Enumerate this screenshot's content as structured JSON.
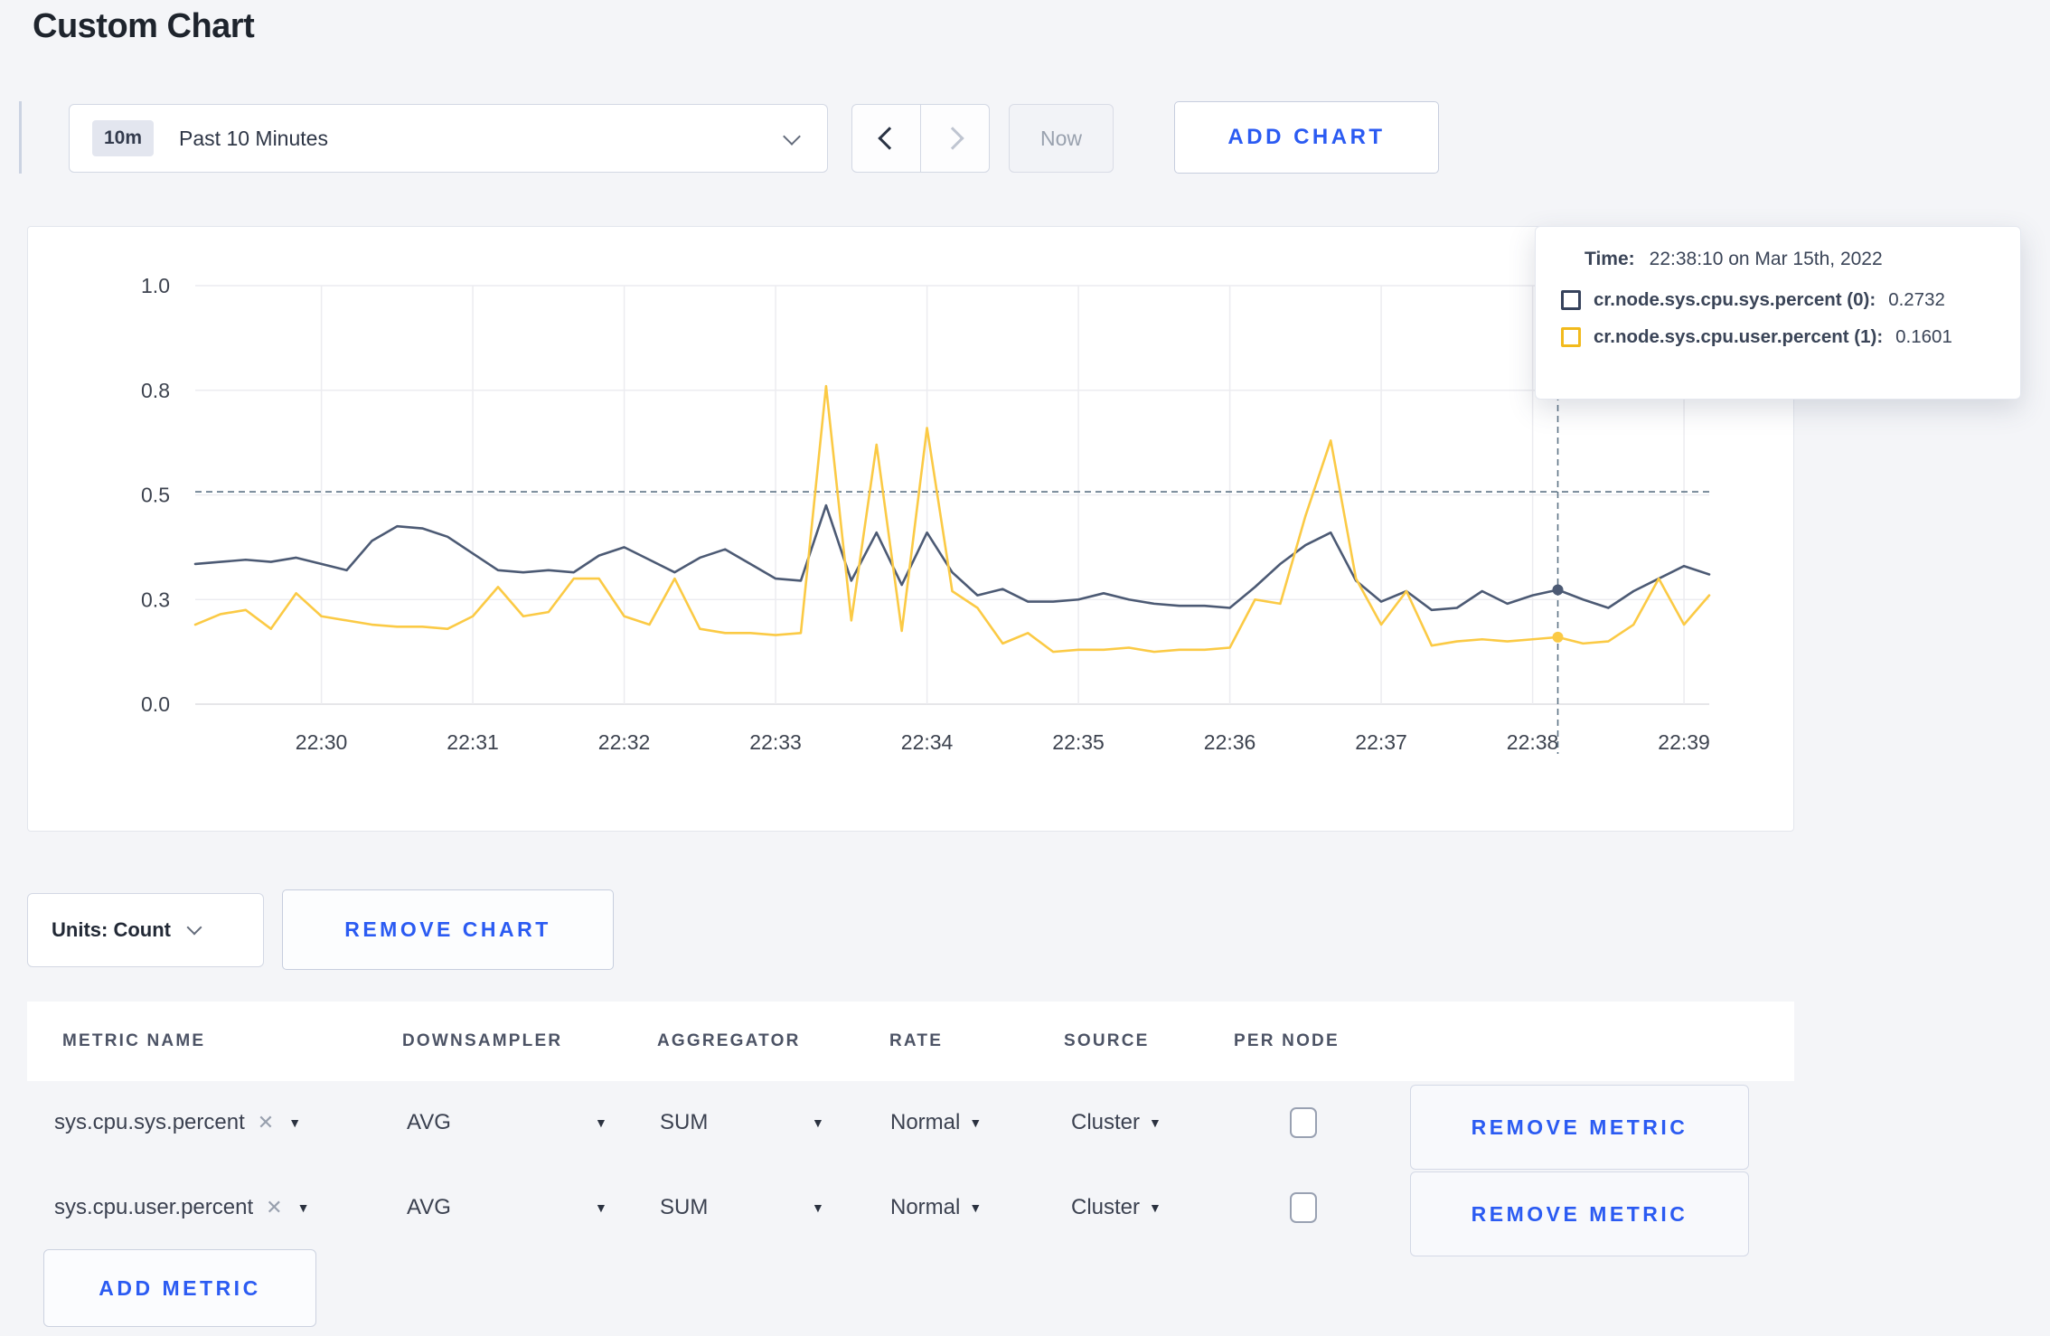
{
  "page": {
    "title": "Custom Chart"
  },
  "toolbar": {
    "time_range": {
      "badge": "10m",
      "label": "Past 10 Minutes"
    },
    "now_label": "Now",
    "add_chart_label": "ADD CHART"
  },
  "chart_data": {
    "type": "line",
    "start_time": "22:29:10",
    "interval_seconds": 10,
    "x_axis": {
      "tick_labels": [
        "22:30",
        "22:31",
        "22:32",
        "22:33",
        "22:34",
        "22:35",
        "22:36",
        "22:37",
        "22:38",
        "22:39"
      ],
      "tick_start_index": 5,
      "ticks_every_points": 6
    },
    "y_axis": {
      "range": [
        0,
        1
      ],
      "ticks": [
        {
          "label": "0.0",
          "value": 0
        },
        {
          "label": "0.3",
          "value": 0.25
        },
        {
          "label": "0.5",
          "value": 0.5
        },
        {
          "label": "0.8",
          "value": 0.75
        },
        {
          "label": "1.0",
          "value": 1
        }
      ]
    },
    "grid_color": "#ececf0",
    "crosshair": {
      "index": 54,
      "h_value": 0.5075,
      "color": "#5e7486"
    },
    "series": [
      {
        "id": "sys",
        "name": "cr.node.sys.cpu.sys.percent (0)",
        "color": "#4c5a74",
        "values": [
          0.335,
          0.34,
          0.345,
          0.34,
          0.35,
          0.335,
          0.32,
          0.39,
          0.425,
          0.42,
          0.4,
          0.36,
          0.32,
          0.315,
          0.32,
          0.315,
          0.355,
          0.375,
          0.345,
          0.315,
          0.35,
          0.37,
          0.335,
          0.3,
          0.295,
          0.475,
          0.295,
          0.41,
          0.285,
          0.41,
          0.315,
          0.26,
          0.275,
          0.245,
          0.245,
          0.25,
          0.265,
          0.25,
          0.24,
          0.235,
          0.235,
          0.23,
          0.28,
          0.335,
          0.38,
          0.41,
          0.295,
          0.245,
          0.27,
          0.225,
          0.23,
          0.27,
          0.24,
          0.26,
          0.2732,
          0.25,
          0.23,
          0.27,
          0.3,
          0.33,
          0.31
        ]
      },
      {
        "id": "user",
        "name": "cr.node.sys.cpu.user.percent (1)",
        "color": "#fbca45",
        "values": [
          0.19,
          0.215,
          0.225,
          0.18,
          0.265,
          0.21,
          0.2,
          0.19,
          0.185,
          0.185,
          0.18,
          0.21,
          0.28,
          0.21,
          0.22,
          0.3,
          0.3,
          0.21,
          0.19,
          0.3,
          0.18,
          0.17,
          0.17,
          0.165,
          0.17,
          0.76,
          0.2,
          0.62,
          0.175,
          0.66,
          0.27,
          0.23,
          0.145,
          0.17,
          0.125,
          0.13,
          0.13,
          0.135,
          0.125,
          0.13,
          0.13,
          0.135,
          0.25,
          0.24,
          0.45,
          0.63,
          0.3,
          0.19,
          0.27,
          0.14,
          0.15,
          0.155,
          0.15,
          0.155,
          0.1601,
          0.145,
          0.15,
          0.19,
          0.3,
          0.19,
          0.26
        ]
      }
    ],
    "tooltip": {
      "time_label": "Time:",
      "time_value": "22:38:10 on Mar 15th, 2022",
      "rows": [
        {
          "name": "cr.node.sys.cpu.sys.percent (0):",
          "value": "0.2732",
          "swatch_color": "#36425c"
        },
        {
          "name": "cr.node.sys.cpu.user.percent (1):",
          "value": "0.1601",
          "swatch_color": "#f2ba1d"
        }
      ]
    }
  },
  "units": {
    "label": "Units: Count"
  },
  "remove_chart_label": "REMOVE CHART",
  "metrics_table": {
    "headers": [
      "METRIC NAME",
      "DOWNSAMPLER",
      "AGGREGATOR",
      "RATE",
      "SOURCE",
      "PER NODE"
    ],
    "rows": [
      {
        "metric_name": "sys.cpu.sys.percent",
        "downsampler": "AVG",
        "aggregator": "SUM",
        "rate": "Normal",
        "source": "Cluster",
        "per_node_checked": false,
        "remove_label": "REMOVE METRIC"
      },
      {
        "metric_name": "sys.cpu.user.percent",
        "downsampler": "AVG",
        "aggregator": "SUM",
        "rate": "Normal",
        "source": "Cluster",
        "per_node_checked": false,
        "remove_label": "REMOVE METRIC"
      }
    ],
    "add_metric_label": "ADD METRIC"
  }
}
